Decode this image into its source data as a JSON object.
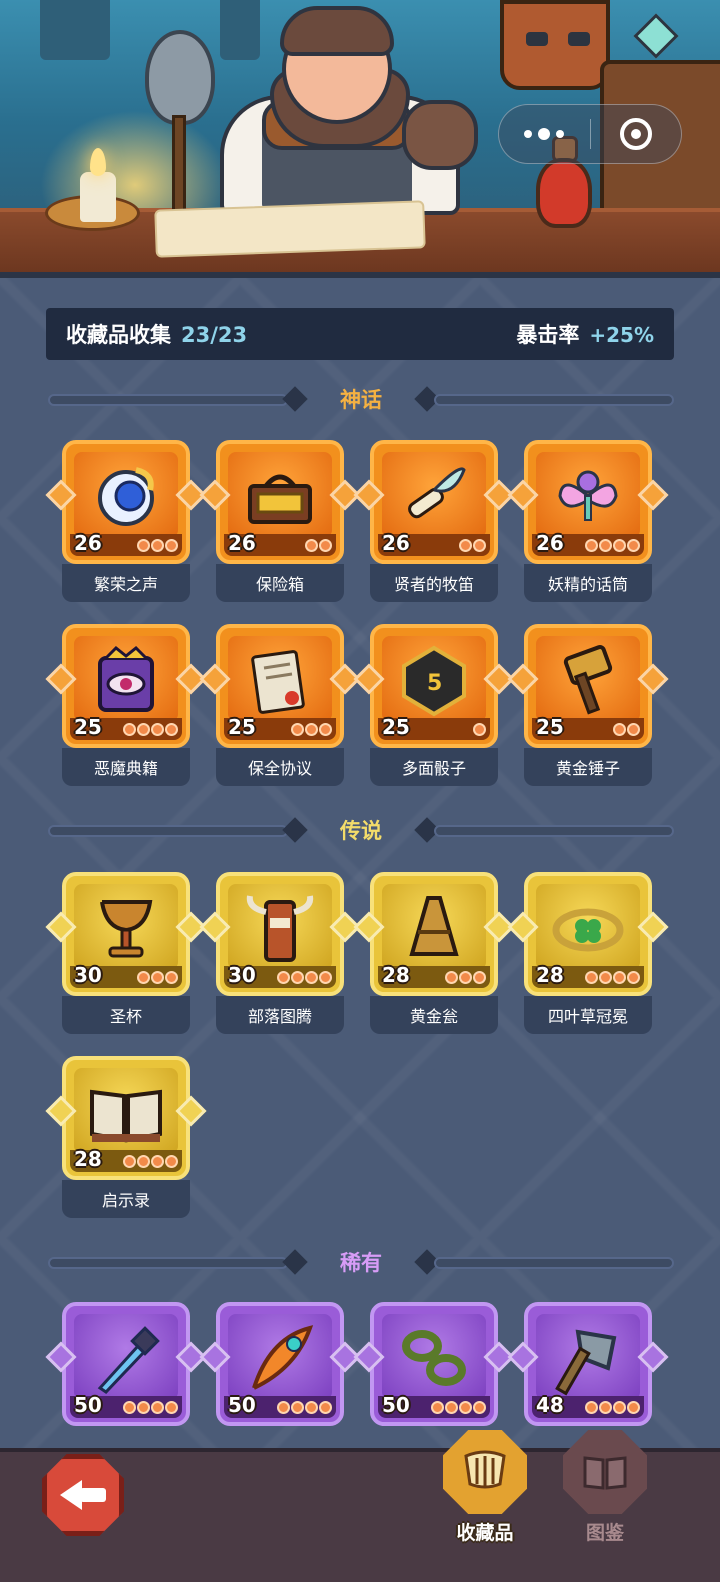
{
  "capsule": {
    "menu_icon": "more-dots-icon",
    "close_icon": "target-icon"
  },
  "summary": {
    "label": "收藏品收集",
    "count": "23/23",
    "stat_label": "暴击率",
    "stat_value": "+25%"
  },
  "colors": {
    "myth": "#f2901d",
    "legend": "#e9c43a",
    "rare": "#9a5cd8",
    "myth_title": "#f5b142",
    "legend_title": "#f3dc6a",
    "rare_title": "#d79cf6"
  },
  "sections": [
    {
      "title": "神话",
      "rarity": "myth",
      "items": [
        {
          "name": "繁荣之声",
          "level": "26",
          "stars": 3,
          "icon": "bell-orb-icon"
        },
        {
          "name": "保险箱",
          "level": "26",
          "stars": 2,
          "icon": "treasure-chest-icon"
        },
        {
          "name": "贤者的牧笛",
          "level": "26",
          "stars": 2,
          "icon": "feather-flute-icon"
        },
        {
          "name": "妖精的话筒",
          "level": "26",
          "stars": 4,
          "icon": "fairy-microphone-icon"
        },
        {
          "name": "恶魔典籍",
          "level": "25",
          "stars": 4,
          "icon": "demon-book-icon"
        },
        {
          "name": "保全协议",
          "level": "25",
          "stars": 3,
          "icon": "contract-scroll-icon"
        },
        {
          "name": "多面骰子",
          "level": "25",
          "stars": 1,
          "icon": "dice-icon"
        },
        {
          "name": "黄金锤子",
          "level": "25",
          "stars": 2,
          "icon": "golden-hammer-icon"
        }
      ]
    },
    {
      "title": "传说",
      "rarity": "legend",
      "items": [
        {
          "name": "圣杯",
          "level": "30",
          "stars": 3,
          "icon": "holy-grail-icon"
        },
        {
          "name": "部落图腾",
          "level": "30",
          "stars": 4,
          "icon": "tribal-totem-icon"
        },
        {
          "name": "黄金瓮",
          "level": "28",
          "stars": 3,
          "icon": "golden-urn-icon"
        },
        {
          "name": "四叶草冠冕",
          "level": "28",
          "stars": 4,
          "icon": "clover-crown-icon"
        },
        {
          "name": "启示录",
          "level": "28",
          "stars": 4,
          "icon": "open-book-icon"
        }
      ]
    },
    {
      "title": "稀有",
      "rarity": "rare",
      "items": [
        {
          "name": "",
          "level": "50",
          "stars": 4,
          "icon": "ice-dagger-icon"
        },
        {
          "name": "",
          "level": "50",
          "stars": 4,
          "icon": "phoenix-feather-icon"
        },
        {
          "name": "",
          "level": "50",
          "stars": 4,
          "icon": "vine-chain-icon"
        },
        {
          "name": "",
          "level": "48",
          "stars": 4,
          "icon": "stone-axe-icon"
        }
      ]
    }
  ],
  "bottom_nav": {
    "back_icon": "back-arrow-icon",
    "tabs": [
      {
        "label": "收藏品",
        "icon": "collection-harp-icon",
        "active": true
      },
      {
        "label": "图鉴",
        "icon": "encyclopedia-book-icon",
        "active": false
      }
    ]
  }
}
